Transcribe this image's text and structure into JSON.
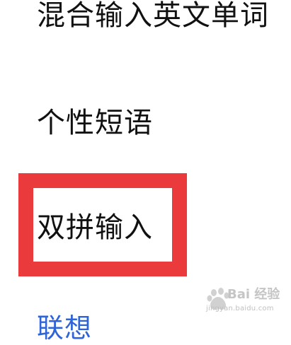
{
  "menu": {
    "items": [
      {
        "label": "混合输入英文单词"
      },
      {
        "label": "个性短语"
      },
      {
        "label": "双拼输入"
      },
      {
        "label": "联想"
      }
    ]
  },
  "highlight": {
    "color": "#ea3a3c"
  },
  "watermark": {
    "brand": "Bai 经验",
    "url": "jingyan.baidu.com"
  },
  "colors": {
    "text": "#111111",
    "link_partial": "#2e64d8"
  }
}
